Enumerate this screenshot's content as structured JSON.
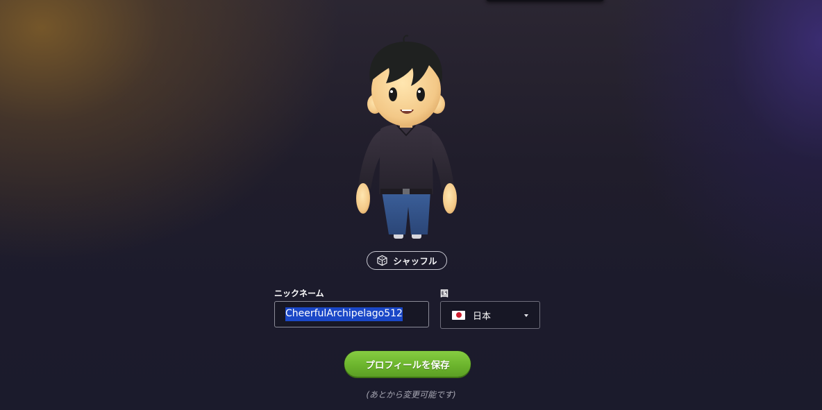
{
  "shuffle": {
    "icon": "dice-icon",
    "label": "シャッフル"
  },
  "form": {
    "nickname": {
      "label": "ニックネーム",
      "value": "CheerfulArchipelago512"
    },
    "country": {
      "label": "国",
      "flag_icon": "japan-flag-icon",
      "value": "日本"
    }
  },
  "save": {
    "label": "プロフィールを保存"
  },
  "note": "(あとから変更可能です)",
  "colors": {
    "save_button": "#6cb52d",
    "selection": "#1a47c7",
    "flag_red": "#cc1f2f"
  }
}
